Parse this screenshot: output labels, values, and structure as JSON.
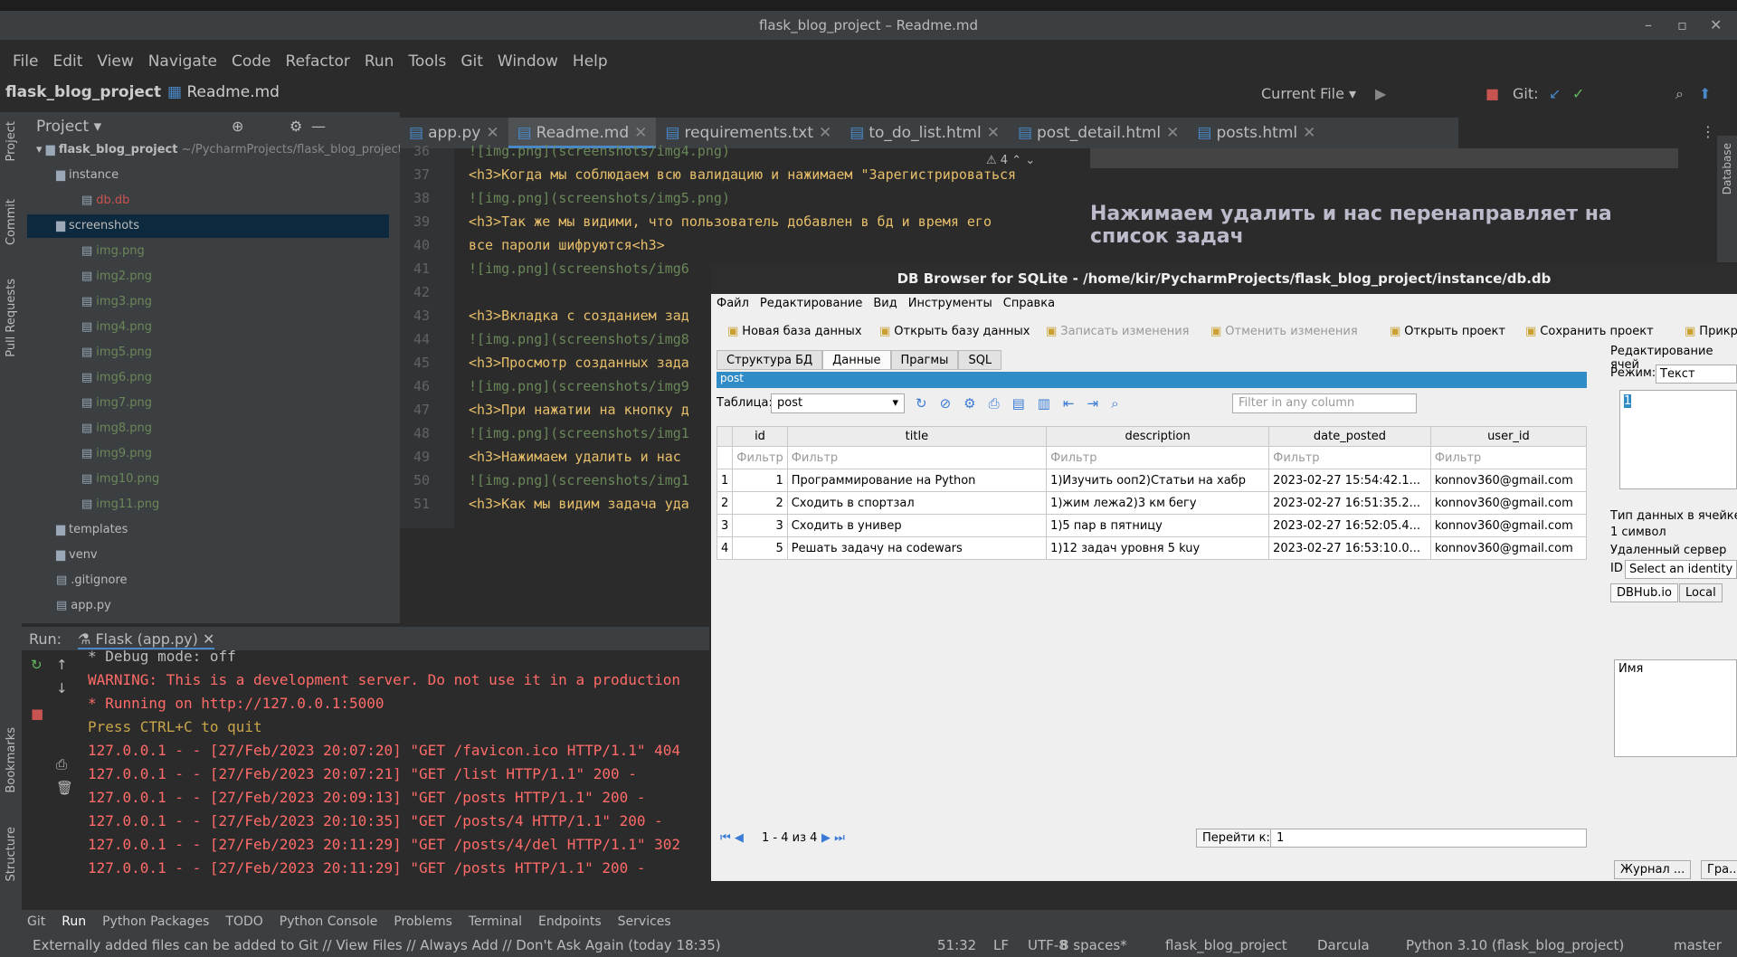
{
  "window": {
    "title": "flask_blog_project – Readme.md"
  },
  "menu": [
    "File",
    "Edit",
    "View",
    "Navigate",
    "Code",
    "Refactor",
    "Run",
    "Tools",
    "Git",
    "Window",
    "Help"
  ],
  "nav": {
    "project": "flask_blog_project",
    "file": "Readme.md",
    "run_config": "Current File",
    "git_label": "Git:"
  },
  "project_panel": {
    "title": "Project",
    "root": "flask_blog_project",
    "root_path": "~/PycharmProjects/flask_blog_project",
    "items": [
      "instance",
      "db.db",
      "screenshots",
      "img.png",
      "img2.png",
      "img3.png",
      "img4.png",
      "img5.png",
      "img6.png",
      "img7.png",
      "img8.png",
      "img9.png",
      "img10.png",
      "img11.png",
      "templates",
      "venv",
      ".gitignore",
      "app.py"
    ]
  },
  "editor_tabs": [
    "app.py",
    "Readme.md",
    "requirements.txt",
    "to_do_list.html",
    "post_detail.html",
    "posts.html"
  ],
  "code_lines": [
    {
      "n": "36",
      "t": "![img.png](screenshots/img4.png)"
    },
    {
      "n": "37",
      "t": "<h3>Когда мы соблюдаем всю валидацию и нажимаем \"Зарегистрироваться"
    },
    {
      "n": "38",
      "t": "![img.png](screenshots/img5.png)"
    },
    {
      "n": "39",
      "t": "<h3>Так же мы видими, что пользователь добавлен в бд и время его"
    },
    {
      "n": "40",
      "t": "все пароли шифруются<h3>"
    },
    {
      "n": "41",
      "t": "![img.png](screenshots/img6"
    },
    {
      "n": "42",
      "t": ""
    },
    {
      "n": "43",
      "t": "<h3>Вкладка с созданием зад"
    },
    {
      "n": "44",
      "t": "![img.png](screenshots/img8"
    },
    {
      "n": "45",
      "t": "<h3>Просмотр созданных зада"
    },
    {
      "n": "46",
      "t": "![img.png](screenshots/img9"
    },
    {
      "n": "47",
      "t": "<h3>При нажатии на кнопку д"
    },
    {
      "n": "48",
      "t": "![img.png](screenshots/img1"
    },
    {
      "n": "49",
      "t": "<h3>Нажимаем удалить и нас"
    },
    {
      "n": "50",
      "t": "![img.png](screenshots/img1"
    },
    {
      "n": "51",
      "t": "<h3>Как мы видим задача уда"
    }
  ],
  "warnings_count": "4",
  "preview": {
    "heading": "Нажимаем удалить и нас перенаправляет на список задач"
  },
  "run": {
    "label": "Run:",
    "config": "Flask (app.py)",
    "lines": [
      {
        "t": " * Debug mode: off",
        "c": "#bbbbbb"
      },
      {
        "t": "WARNING: This is a development server. Do not use it in a production",
        "c": "#ff6b68"
      },
      {
        "t": " * Running on http://127.0.0.1:5000",
        "c": "#ff6b68"
      },
      {
        "t": "Press CTRL+C to quit",
        "c": "#c9a54a"
      },
      {
        "t": "127.0.0.1 - - [27/Feb/2023 20:07:20] \"GET /favicon.ico HTTP/1.1\" 404",
        "c": "#ff6b68"
      },
      {
        "t": "127.0.0.1 - - [27/Feb/2023 20:07:21] \"GET /list HTTP/1.1\" 200 -",
        "c": "#ff6b68"
      },
      {
        "t": "127.0.0.1 - - [27/Feb/2023 20:09:13] \"GET /posts HTTP/1.1\" 200 -",
        "c": "#ff6b68"
      },
      {
        "t": "127.0.0.1 - - [27/Feb/2023 20:10:35] \"GET /posts/4 HTTP/1.1\" 200 -",
        "c": "#ff6b68"
      },
      {
        "t": "127.0.0.1 - - [27/Feb/2023 20:11:29] \"GET /posts/4/del HTTP/1.1\" 302",
        "c": "#ff6b68"
      },
      {
        "t": "127.0.0.1 - - [27/Feb/2023 20:11:29] \"GET /posts HTTP/1.1\" 200 -",
        "c": "#ff6b68"
      }
    ]
  },
  "bottom_tabs": [
    "Git",
    "Run",
    "Python Packages",
    "TODO",
    "Python Console",
    "Problems",
    "Terminal",
    "Endpoints",
    "Services"
  ],
  "status": {
    "message": "Externally added files can be added to Git // View Files // Always Add // Don't Ask Again (today 18:35)",
    "pos": "51:32",
    "eol": "LF",
    "enc": "UTF-8",
    "indent": "8 spaces*",
    "project": "flask_blog_project",
    "theme": "Darcula",
    "interpreter": "Python 3.10 (flask_blog_project)",
    "branch": "master"
  },
  "db": {
    "title": "DB Browser for SQLite - /home/kir/PycharmProjects/flask_blog_project/instance/db.db",
    "menu": [
      "Файл",
      "Редактирование",
      "Вид",
      "Инструменты",
      "Справка"
    ],
    "tools": [
      "Новая база данных",
      "Открыть базу данных",
      "Записать изменения",
      "Отменить изменения",
      "Открыть проект",
      "Сохранить проект",
      "Прикр"
    ],
    "tabs": [
      "Структура БД",
      "Данные",
      "Прагмы",
      "SQL"
    ],
    "panel_name": "post",
    "table_label": "Таблица:",
    "table_value": "post",
    "filter_placeholder": "Filter in any column",
    "columns": [
      "id",
      "title",
      "description",
      "date_posted",
      "user_id"
    ],
    "filter_label": "Фильтр",
    "rows": [
      [
        "1",
        "1",
        "Программирование на Python",
        "1)Изучить ооп2)Статьи на хабр",
        "2023-02-27 15:54:42.1...",
        "konnov360@gmail.com"
      ],
      [
        "2",
        "2",
        "Сходить в спортзал",
        "1)жим лежа2)3 км бегу",
        "2023-02-27 16:51:35.2...",
        "konnov360@gmail.com"
      ],
      [
        "3",
        "3",
        "Сходить в универ",
        "1)5 пар в пятницу",
        "2023-02-27 16:52:05.4...",
        "konnov360@gmail.com"
      ],
      [
        "4",
        "5",
        "Решать задачу на codewars",
        "1)12 задач уровня 5 kuy",
        "2023-02-27 16:53:10.0...",
        "konnov360@gmail.com"
      ]
    ],
    "pager": "1 - 4 из 4",
    "goto_label": "Перейти к:",
    "goto_value": "1",
    "right": {
      "title": "Редактирование ячей",
      "mode_label": "Режим:",
      "mode_value": "Текст",
      "cell_value": "1",
      "type_label": "Тип данных в ячейке",
      "type_value": "1 символ",
      "remote": "Удаленный сервер",
      "id_label": "ID",
      "id_value": "Select an identity t",
      "tab1": "DBHub.io",
      "tab2": "Local",
      "name_col": "Имя",
      "bottom1": "Журнал ...",
      "bottom2": "Гра..."
    }
  }
}
